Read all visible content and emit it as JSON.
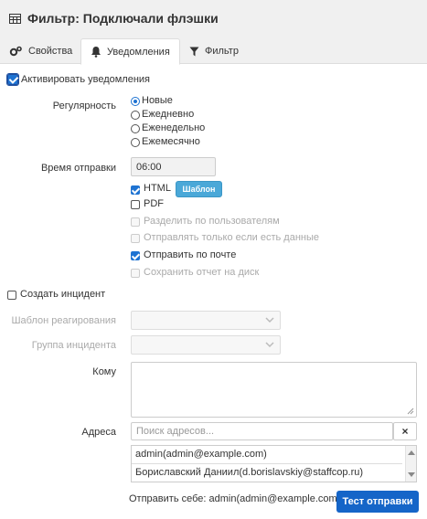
{
  "header": {
    "title": "Фильтр: Подключали флэшки",
    "tabs": [
      {
        "label": "Свойства",
        "icon": "gears-icon"
      },
      {
        "label": "Уведомления",
        "icon": "bell-icon",
        "active": true
      },
      {
        "label": "Фильтр",
        "icon": "funnel-icon"
      }
    ]
  },
  "notify": {
    "activate_label": "Активировать уведомления",
    "activate_checked": true,
    "regularity_label": "Регулярность",
    "regularity_options": [
      "Новые",
      "Ежедневно",
      "Еженедельно",
      "Ежемесячно"
    ],
    "regularity_selected": "Новые",
    "send_time_label": "Время отправки",
    "send_time_value": "06:00",
    "html_label": "HTML",
    "html_checked": true,
    "template_button": "Шаблон",
    "pdf_label": "PDF",
    "pdf_checked": false,
    "split_by_users": "Разделить по пользователям",
    "send_only_if_data": "Отправлять только если есть данные",
    "send_by_mail": "Отправить по почте",
    "send_by_mail_checked": true,
    "save_to_disk": "Сохранить отчет на диск"
  },
  "incident": {
    "create_label": "Создать инцидент",
    "create_checked": false,
    "response_template_label": "Шаблон реагирования",
    "incident_group_label": "Группа инцидента"
  },
  "recipients": {
    "to_label": "Кому",
    "addresses_label": "Адреса",
    "search_placeholder": "Поиск адресов...",
    "clear_button": "×",
    "address_list": [
      "admin(admin@example.com)",
      "Бориславский Даниил(d.borislavskiy@staffcop.ru)"
    ],
    "send_self_label": "Отправить себе: admin(admin@example.com)",
    "test_send_button": "Тест отправки"
  },
  "colors": {
    "accent": "#1e73d2",
    "send_button": "#1565c8",
    "template_button": "#4aa8d8"
  }
}
